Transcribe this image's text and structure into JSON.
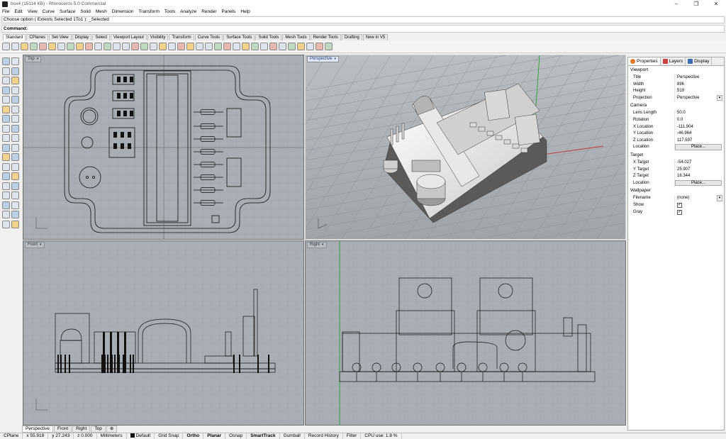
{
  "window": {
    "title": "box4 (15114 KB) - Rhinoceros 5.0 Commercial",
    "controls": [
      "–",
      "❐",
      "✕"
    ]
  },
  "menu": [
    "File",
    "Edit",
    "View",
    "Curve",
    "Surface",
    "Solid",
    "Mesh",
    "Dimension",
    "Transform",
    "Tools",
    "Analyze",
    "Render",
    "Panels",
    "Help"
  ],
  "command": {
    "history": "Choose option ( Extents  Selected  1To1 ): _Selected",
    "prompt": "Command:"
  },
  "toolbar_tabs": [
    "Standard",
    "CPlanes",
    "Set View",
    "Display",
    "Select",
    "Viewport Layout",
    "Visibility",
    "Transform",
    "Curve Tools",
    "Surface Tools",
    "Solid Tools",
    "Mesh Tools",
    "Render Tools",
    "Drafting",
    "New in V5"
  ],
  "viewports": {
    "top": {
      "label": "Top"
    },
    "perspective": {
      "label": "Perspective"
    },
    "front": {
      "label": "Front"
    },
    "right": {
      "label": "Right"
    }
  },
  "bottom_tabs": [
    "Perspective",
    "Front",
    "Right",
    "Top",
    "⊕"
  ],
  "status": {
    "cplane": "CPlane",
    "x": "x 55.918",
    "y": "y 27.243",
    "z": "z 0.000",
    "units": "Millimeters",
    "layer": "Default",
    "grid_snap": "Grid Snap",
    "ortho": "Ortho",
    "planar": "Planar",
    "osnap": "Osnap",
    "smarttrack": "SmartTrack",
    "gumball": "Gumball",
    "record": "Record History",
    "filter": "Filter",
    "cpu": "CPU use: 1.8 %"
  },
  "panel": {
    "tabs": [
      "Properties",
      "Layers",
      "Display"
    ],
    "tab_colors": [
      "#e07a2a",
      "#d04040",
      "#3a6ab0"
    ],
    "sections": {
      "viewport": {
        "title": "Viewport",
        "rows": [
          {
            "k": "Title",
            "v": "Perspective"
          },
          {
            "k": "Width",
            "v": "896"
          },
          {
            "k": "Height",
            "v": "519"
          },
          {
            "k": "Projection",
            "v": "Perspective"
          }
        ]
      },
      "camera": {
        "title": "Camera",
        "rows": [
          {
            "k": "Lens Length",
            "v": "50.0"
          },
          {
            "k": "Rotation",
            "v": "0.0"
          },
          {
            "k": "X Location",
            "v": "-111.904"
          },
          {
            "k": "Y Location",
            "v": "-46.964"
          },
          {
            "k": "Z Location",
            "v": "117.597"
          },
          {
            "k": "Location",
            "v": "Place..."
          }
        ]
      },
      "target": {
        "title": "Target",
        "rows": [
          {
            "k": "X Target",
            "v": "-54.027"
          },
          {
            "k": "Y Target",
            "v": "25.907"
          },
          {
            "k": "Z Target",
            "v": "16.344"
          },
          {
            "k": "Location",
            "v": "Place..."
          }
        ]
      },
      "wallpaper": {
        "title": "Wallpaper",
        "rows": [
          {
            "k": "Filename",
            "v": "(none)"
          },
          {
            "k": "Show",
            "v": "✓"
          },
          {
            "k": "Gray",
            "v": "✓"
          }
        ]
      }
    }
  }
}
